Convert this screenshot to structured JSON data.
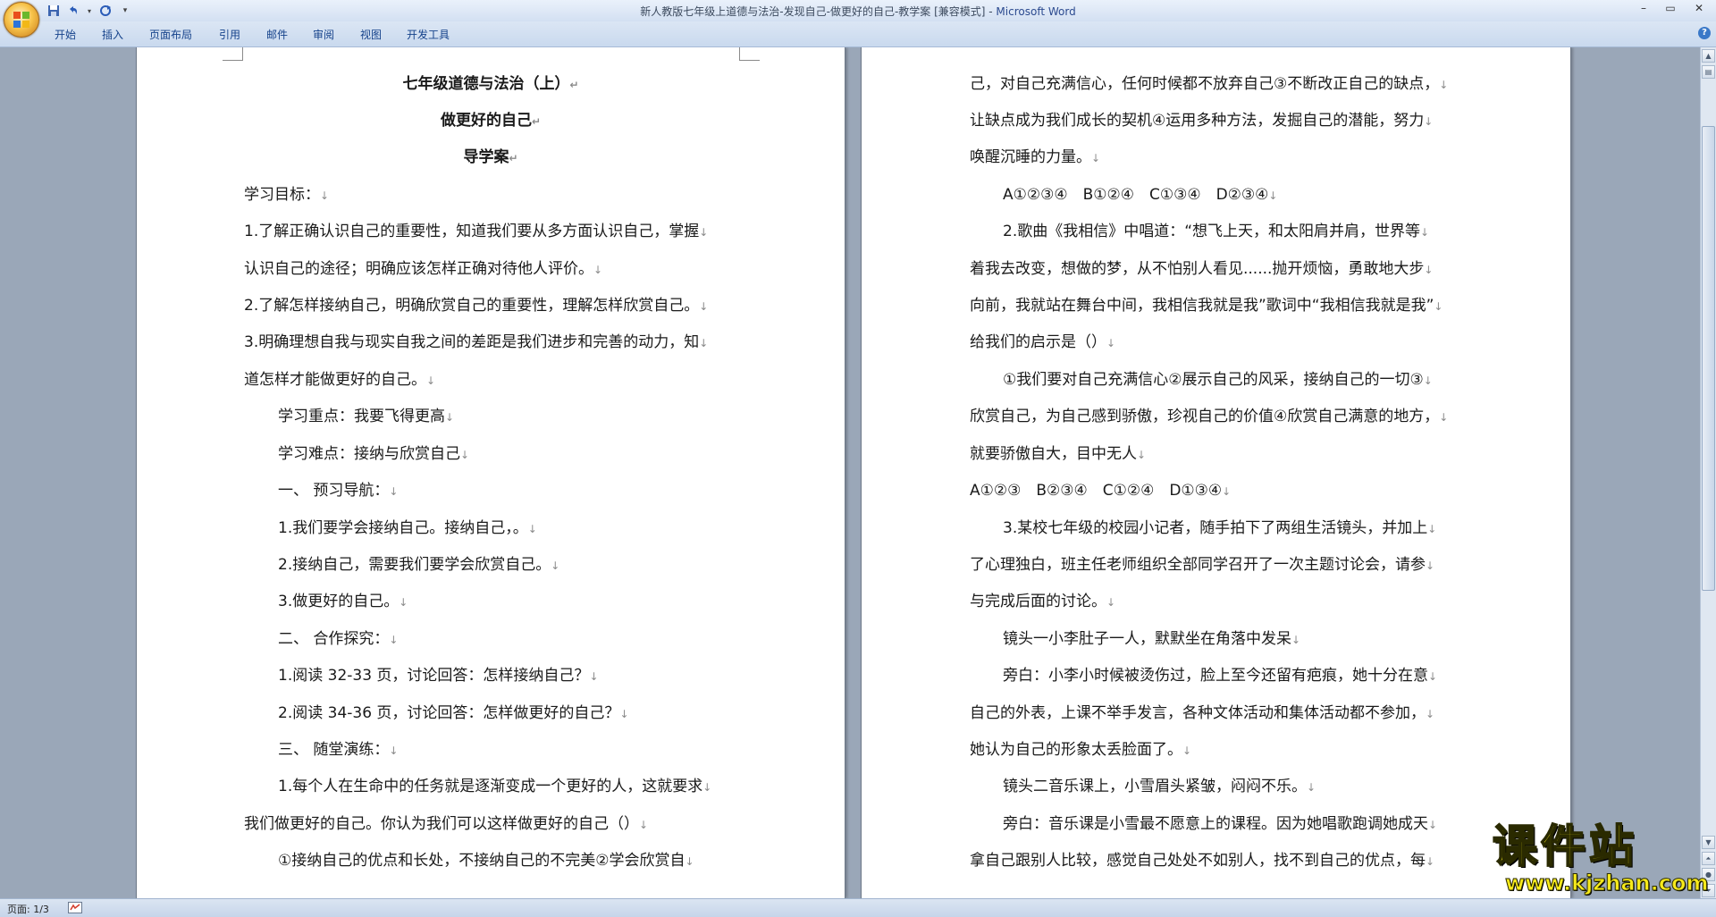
{
  "window": {
    "title_doc": "新人教版七年级上道德与法治-发现自己-做更好的自己-教学案 [兼容模式] - ",
    "title_app": "Microsoft Word"
  },
  "quick_access": [
    "save-icon",
    "undo-icon",
    "redo-icon",
    "customize-icon"
  ],
  "window_controls": {
    "minimize": "–",
    "maximize": "▭",
    "close": "✕"
  },
  "ribbon": {
    "tabs": [
      "开始",
      "插入",
      "页面布局",
      "引用",
      "邮件",
      "审阅",
      "视图",
      "开发工具"
    ],
    "help": "?"
  },
  "left_page": {
    "title1": "七年级道德与法治（上）",
    "title2": "做更好的自己",
    "title3": "导学案",
    "lines": [
      "学习目标：",
      "1.了解正确认识自己的重要性，知道我们要从多方面认识自己，掌握",
      "认识自己的途径；明确应该怎样正确对待他人评价。",
      "2.了解怎样接纳自己，明确欣赏自己的重要性，理解怎样欣赏自己。",
      "3.明确理想自我与现实自我之间的差距是我们进步和完善的动力，知",
      "道怎样才能做更好的自己。",
      "学习重点：我要飞得更高",
      "学习难点：接纳与欣赏自己",
      "一、 预习导航：",
      "1.我们要学会接纳自己。接纳自己，。",
      "2.接纳自己，需要我们要学会欣赏自己。",
      "3.做更好的自己。",
      "二、 合作探究：",
      "1.阅读 32-33 页，讨论回答：怎样接纳自己？",
      "2.阅读 34-36 页，讨论回答：怎样做更好的自己？",
      "三、 随堂演练：",
      "1.每个人在生命中的任务就是逐渐变成一个更好的人，这就要求",
      "我们做更好的自己。你认为我们可以这样做更好的自己（）",
      "①接纳自己的优点和长处，不接纳自己的不完美②学会欣赏自"
    ]
  },
  "right_page": {
    "lines": [
      "己，对自己充满信心，任何时候都不放弃自己③不断改正自己的缺点，",
      "让缺点成为我们成长的契机④运用多种方法，发掘自己的潜能，努力",
      "唤醒沉睡的力量。",
      "A①②③④　B①②④　C①③④　D②③④",
      "2.歌曲《我相信》中唱道：“想飞上天，和太阳肩并肩，世界等",
      "着我去改变，想做的梦，从不怕别人看见......抛开烦恼，勇敢地大步",
      "向前，我就站在舞台中间，我相信我就是我”歌词中“我相信我就是我”",
      "给我们的启示是（）",
      "①我们要对自己充满信心②展示自己的风采，接纳自己的一切③",
      "欣赏自己，为自己感到骄傲，珍视自己的价值④欣赏自己满意的地方，",
      "就要骄傲自大，目中无人",
      "A①②③　B②③④　C①②④　D①③④",
      "3.某校七年级的校园小记者，随手拍下了两组生活镜头，并加上",
      "了心理独白，班主任老师组织全部同学召开了一次主题讨论会，请参",
      "与完成后面的讨论。",
      "镜头一小李肚子一人，默默坐在角落中发呆",
      "旁白：小李小时候被烫伤过，脸上至今还留有疤痕，她十分在意",
      "自己的外表，上课不举手发言，各种文体活动和集体活动都不参加，",
      "她认为自己的形象太丢脸面了。",
      "镜头二音乐课上，小雪眉头紧皱，闷闷不乐。",
      "旁白：音乐课是小雪最不愿意上的课程。因为她唱歌跑调她成天",
      "拿自己跟别人比较，感觉自己处处不如别人，找不到自己的优点，每"
    ]
  },
  "status_bar": {
    "page": "页面: 1/3"
  },
  "watermark": {
    "text": "课件站",
    "url": "www.kjzhan.com"
  },
  "colors": {
    "ribbon_text": "#15428b",
    "background": "#9aa7b8",
    "watermark": "#f7ea1b"
  }
}
